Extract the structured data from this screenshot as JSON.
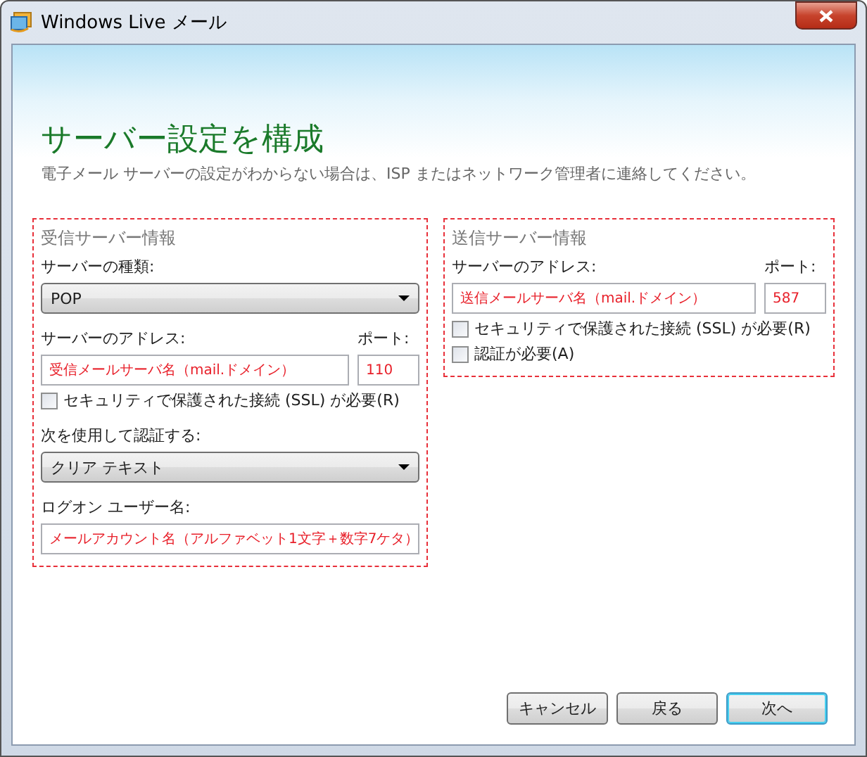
{
  "window": {
    "title": "Windows Live メール"
  },
  "heading": "サーバー設定を構成",
  "description": "電子メール サーバーの設定がわからない場合は、ISP またはネットワーク管理者に連絡してください。",
  "incoming": {
    "title": "受信サーバー情報",
    "server_type": {
      "label": "サーバーの種類:",
      "value": "POP"
    },
    "address": {
      "label": "サーバーのアドレス:",
      "value": "受信メールサーバ名（mail.ドメイン）"
    },
    "port": {
      "label": "ポート:",
      "value": "110"
    },
    "checkboxes": [
      {
        "label": "セキュリティで保護された接続 (SSL) が必要(R)",
        "checked": false
      }
    ],
    "auth": {
      "label": "次を使用して認証する:",
      "value": "クリア テキスト"
    },
    "logon": {
      "label": "ログオン ユーザー名:",
      "value": "メールアカウント名（アルファベット1文字＋数字7ケタ）"
    }
  },
  "outgoing": {
    "title": "送信サーバー情報",
    "address": {
      "label": "サーバーのアドレス:",
      "value": "送信メールサーバ名（mail.ドメイン）"
    },
    "port": {
      "label": "ポート:",
      "value": "587"
    },
    "checkboxes": [
      {
        "label": "セキュリティで保護された接続 (SSL) が必要(R)",
        "checked": false
      },
      {
        "label": "認証が必要(A)",
        "checked": false
      }
    ]
  },
  "buttons": [
    {
      "label": "キャンセル",
      "default": false
    },
    {
      "label": "戻る",
      "default": false
    },
    {
      "label": "次へ",
      "default": true
    }
  ]
}
